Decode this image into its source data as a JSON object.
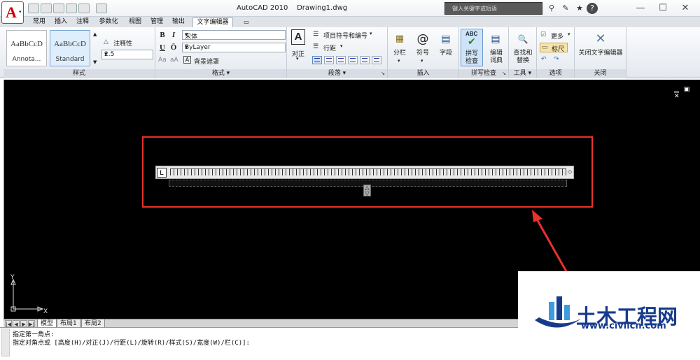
{
  "window": {
    "app_title": "AutoCAD 2010",
    "doc_title": "Drawing1.dwg",
    "minimize": "—",
    "maximize": "☐",
    "close": "✕"
  },
  "search": {
    "placeholder": "键入关键字或短语"
  },
  "tabs": [
    {
      "label": "常用"
    },
    {
      "label": "插入"
    },
    {
      "label": "注释"
    },
    {
      "label": "参数化"
    },
    {
      "label": "视图"
    },
    {
      "label": "管理"
    },
    {
      "label": "输出"
    },
    {
      "label": "文字编辑器"
    }
  ],
  "ribbon": {
    "style": {
      "title": "样式",
      "style1_sample": "AaBbCcD",
      "style1_label": "Annota...",
      "style2_sample": "AaBbCcD",
      "style2_label": "Standard",
      "annotative_label": "注释性",
      "height_value": "2.5"
    },
    "format": {
      "title": "格式",
      "bold": "B",
      "italic": "I",
      "underline": "U",
      "overline": "Ō",
      "font_value": "宋体",
      "color_value": "ByLayer",
      "case_upper": "Aa",
      "case_lower": "aA",
      "mask_label": "背景遮罩"
    },
    "paragraph": {
      "title": "段落",
      "justify_label": "对正",
      "bullets_label": "项目符号和编号",
      "spacing_label": "行距"
    },
    "insert": {
      "title": "插入",
      "columns_label": "分栏",
      "symbol_label": "符号",
      "field_label": "字段"
    },
    "spell": {
      "title": "拼写检查",
      "check_label1": "拼写",
      "check_label2": "检查",
      "dict_label1": "编辑",
      "dict_label2": "词典"
    },
    "tools": {
      "title": "工具",
      "find_label1": "查找和",
      "find_label2": "替换"
    },
    "options": {
      "title": "选项",
      "more_label": "更多",
      "ruler_label": "标尺"
    },
    "close": {
      "title": "关闭",
      "close_label": "关闭文字编辑器"
    }
  },
  "drawing": {
    "ucs_y": "Y",
    "ucs_x": "X",
    "ruler_link": "L"
  },
  "layout_tabs": [
    {
      "label": "模型"
    },
    {
      "label": "布局1"
    },
    {
      "label": "布局2"
    }
  ],
  "command": {
    "line1": "指定第一角点:",
    "line2": "指定对角点或 [高度(H)/对正(J)/行距(L)/旋转(R)/样式(S)/宽度(W)/栏(C)]:"
  },
  "watermark": {
    "title": "土木工程网",
    "url": "www.civilcn.com"
  },
  "colors": {
    "accent": "#e8322a",
    "canvas": "#000000",
    "brand": "#173b8c"
  }
}
